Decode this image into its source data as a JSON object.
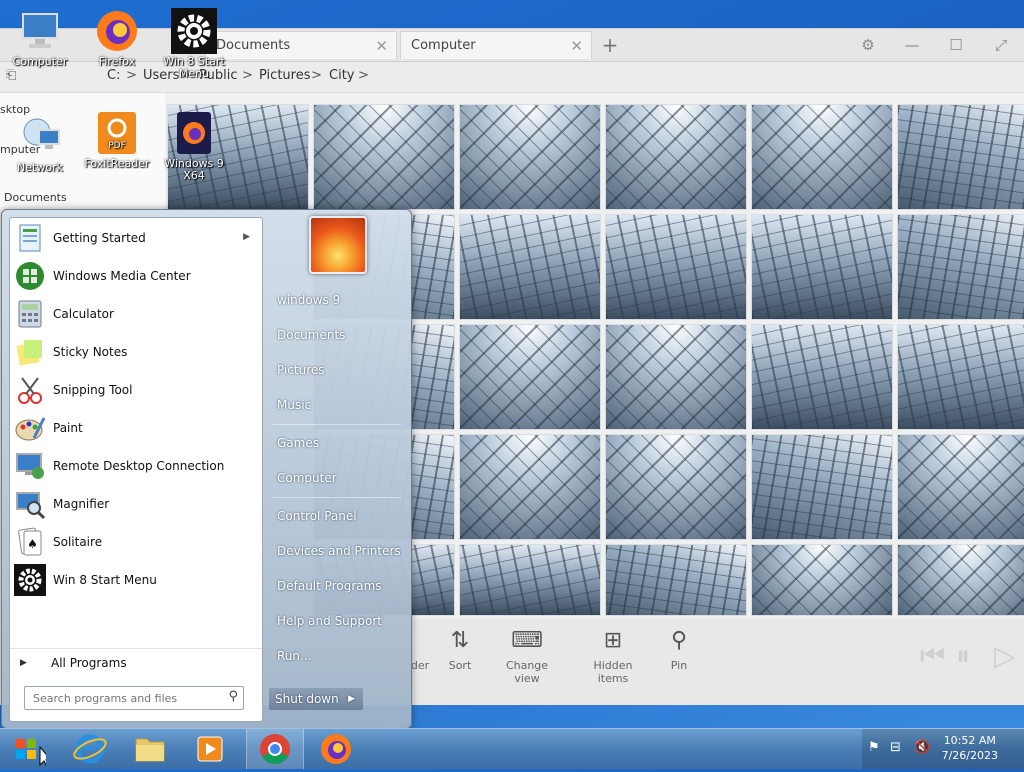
{
  "explorer": {
    "tabs": [
      {
        "label": "Documents"
      },
      {
        "label": "Computer"
      }
    ],
    "tab_close": "✕",
    "tab_add": "+",
    "window_controls": {
      "settings": "⚙",
      "minimize": "—",
      "maximize": "☐",
      "restore": "⤢"
    },
    "breadcrumb": [
      "C:",
      "Users",
      "Public",
      "Pictures",
      "City"
    ],
    "breadcrumb_separator": ">",
    "left_pane": [
      "sktop",
      "mputer",
      "Documents"
    ],
    "commands": [
      {
        "label": "der",
        "icon": "view-icon"
      },
      {
        "label": "Sort",
        "icon": "sort-icon"
      },
      {
        "label": "Change view",
        "icon": "change-view-icon"
      },
      {
        "label": "Hidden items",
        "icon": "hidden-items-icon"
      },
      {
        "label": "Pin",
        "icon": "pin-icon"
      }
    ],
    "media_controls": {
      "previous": "⏮",
      "pause": "⏸",
      "play": "▷"
    }
  },
  "desktop_icons": [
    {
      "label": "Computer",
      "icon": "computer-icon"
    },
    {
      "label": "Firefox",
      "icon": "firefox-icon"
    },
    {
      "label": "Win 8 Start Menu",
      "icon": "gear-icon"
    },
    {
      "label": "Network",
      "icon": "network-icon"
    },
    {
      "label": "FoxitReader",
      "icon": "foxit-pdf-icon"
    },
    {
      "label": "Windows 9 X64",
      "icon": "firefox-dark-icon"
    }
  ],
  "start_menu": {
    "programs": [
      {
        "label": "Getting Started",
        "icon": "getting-started-icon",
        "has_submenu": true
      },
      {
        "label": "Windows Media Center",
        "icon": "media-center-icon"
      },
      {
        "label": "Calculator",
        "icon": "calculator-icon"
      },
      {
        "label": "Sticky Notes",
        "icon": "sticky-notes-icon"
      },
      {
        "label": "Snipping Tool",
        "icon": "snipping-tool-icon"
      },
      {
        "label": "Paint",
        "icon": "paint-icon"
      },
      {
        "label": "Remote Desktop Connection",
        "icon": "remote-desktop-icon"
      },
      {
        "label": "Magnifier",
        "icon": "magnifier-icon"
      },
      {
        "label": "Solitaire",
        "icon": "solitaire-icon"
      },
      {
        "label": "Win 8 Start Menu",
        "icon": "gear-icon"
      }
    ],
    "all_programs": "All Programs",
    "search_placeholder": "Search programs and files",
    "right_items": [
      "windows 9",
      "Documents",
      "Pictures",
      "Music",
      "Games",
      "Computer",
      "Control Panel",
      "Devices and Printers",
      "Default Programs",
      "Help and Support",
      "Run..."
    ],
    "shutdown": "Shut down"
  },
  "taskbar": {
    "pinned": [
      {
        "name": "internet-explorer",
        "icon": "ie-icon"
      },
      {
        "name": "file-explorer",
        "icon": "folder-icon"
      },
      {
        "name": "media-player",
        "icon": "media-player-icon"
      },
      {
        "name": "chrome",
        "icon": "chrome-icon"
      },
      {
        "name": "firefox",
        "icon": "firefox-icon"
      }
    ],
    "time": "10:52 AM",
    "date": "7/26/2023"
  }
}
